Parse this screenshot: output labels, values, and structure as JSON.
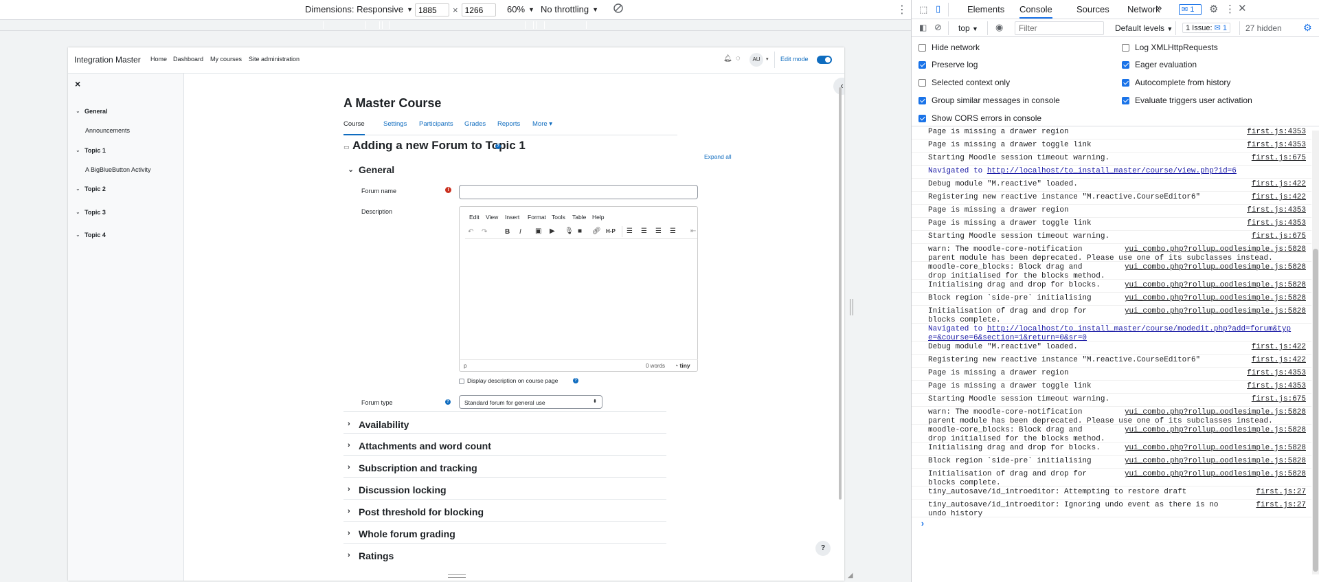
{
  "device_toolbar": {
    "dimensions_label": "Dimensions: Responsive",
    "width": "1885",
    "times": "×",
    "height": "1266",
    "zoom": "60%",
    "throttle": "No throttling"
  },
  "site": {
    "brand": "Integration Master",
    "nav": [
      "Home",
      "Dashboard",
      "My courses",
      "Site administration"
    ],
    "avatar": "AU",
    "edit_mode": "Edit mode"
  },
  "drawer": {
    "close": "×",
    "sections": [
      {
        "name": "General",
        "activity": "Announcements"
      },
      {
        "name": "Topic 1",
        "activity": "A BigBlueButton Activity"
      },
      {
        "name": "Topic 2",
        "activity": ""
      },
      {
        "name": "Topic 3",
        "activity": ""
      },
      {
        "name": "Topic 4",
        "activity": ""
      }
    ]
  },
  "course": {
    "title": "A Master Course",
    "tabs": [
      "Course",
      "Settings",
      "Participants",
      "Grades",
      "Reports",
      "More"
    ],
    "form_title": "Adding a new Forum to Topic 1",
    "expand_all": "Expand all",
    "general": "General",
    "forum_name_label": "Forum name",
    "forum_name_value": "",
    "description_label": "Description",
    "editor_menu": [
      "Edit",
      "View",
      "Insert",
      "Format",
      "Tools",
      "Table",
      "Help"
    ],
    "editor_status_path": "p",
    "editor_words": "0 words",
    "editor_brand": "tiny",
    "display_desc": "Display description on course page",
    "forum_type_label": "Forum type",
    "forum_type_value": "Standard forum for general use",
    "sections": [
      "Availability",
      "Attachments and word count",
      "Subscription and tracking",
      "Discussion locking",
      "Post threshold for blocking",
      "Whole forum grading",
      "Ratings"
    ]
  },
  "devtools": {
    "tabs": [
      "Elements",
      "Console",
      "Sources",
      "Network"
    ],
    "more": "»",
    "msg_badge": "1",
    "context": "top",
    "filter_placeholder": "Filter",
    "levels": "Default levels",
    "issues": "1 Issue:",
    "issues_count": "1",
    "hidden": "27 hidden",
    "settings_left": [
      {
        "label": "Hide network",
        "checked": false
      },
      {
        "label": "Preserve log",
        "checked": true
      },
      {
        "label": "Selected context only",
        "checked": false
      },
      {
        "label": "Group similar messages in console",
        "checked": true
      },
      {
        "label": "Show CORS errors in console",
        "checked": true
      }
    ],
    "settings_right": [
      {
        "label": "Log XMLHttpRequests",
        "checked": false
      },
      {
        "label": "Eager evaluation",
        "checked": true
      },
      {
        "label": "Autocomplete from history",
        "checked": true
      },
      {
        "label": "Evaluate triggers user activation",
        "checked": true
      }
    ],
    "log": [
      {
        "msg": "Page is missing a drawer region",
        "src": "first.js:4353",
        "type": ""
      },
      {
        "msg": "Page is missing a drawer toggle link",
        "src": "first.js:4353",
        "type": ""
      },
      {
        "msg": "Starting Moodle session timeout warning.",
        "src": "first.js:675",
        "type": ""
      },
      {
        "msg": "Navigated to ",
        "link": "http://localhost/to_install_master/course/view.php?id=6",
        "src": "",
        "type": "nav"
      },
      {
        "msg": "Debug module \"M.reactive\" loaded.",
        "src": "first.js:422",
        "type": ""
      },
      {
        "msg": "Registering new reactive instance \"M.reactive.CourseEditor6\"",
        "src": "first.js:422",
        "type": ""
      },
      {
        "msg": "Page is missing a drawer region",
        "src": "first.js:4353",
        "type": ""
      },
      {
        "msg": "Page is missing a drawer toggle link",
        "src": "first.js:4353",
        "type": ""
      },
      {
        "msg": "Starting Moodle session timeout warning.",
        "src": "first.js:675",
        "type": ""
      },
      {
        "msg": "warn: The moodle-core-notification\nparent module has been deprecated. Please use one of its subclasses instead.",
        "src": "yui_combo.php?rollup…oodlesimple.js:5828",
        "type": "two"
      },
      {
        "msg": "moodle-core_blocks: Block drag and\ndrop initialised for the blocks method.",
        "src": "yui_combo.php?rollup…oodlesimple.js:5828",
        "type": "two"
      },
      {
        "msg": "Initialising drag and drop for blocks.",
        "src": "yui_combo.php?rollup…oodlesimple.js:5828",
        "type": ""
      },
      {
        "msg": "Block region `side-pre` initialising",
        "src": "yui_combo.php?rollup…oodlesimple.js:5828",
        "type": ""
      },
      {
        "msg": "Initialisation of drag and drop for\nblocks complete.",
        "src": "yui_combo.php?rollup…oodlesimple.js:5828",
        "type": "two"
      },
      {
        "msg": "Navigated to ",
        "link": "http://localhost/to_install_master/course/modedit.php?add=forum&typ\ne=&course=6&section=1&return=0&sr=0",
        "src": "",
        "type": "nav two"
      },
      {
        "msg": "Debug module \"M.reactive\" loaded.",
        "src": "first.js:422",
        "type": ""
      },
      {
        "msg": "Registering new reactive instance \"M.reactive.CourseEditor6\"",
        "src": "first.js:422",
        "type": ""
      },
      {
        "msg": "Page is missing a drawer region",
        "src": "first.js:4353",
        "type": ""
      },
      {
        "msg": "Page is missing a drawer toggle link",
        "src": "first.js:4353",
        "type": ""
      },
      {
        "msg": "Starting Moodle session timeout warning.",
        "src": "first.js:675",
        "type": ""
      },
      {
        "msg": "warn: The moodle-core-notification\nparent module has been deprecated. Please use one of its subclasses instead.",
        "src": "yui_combo.php?rollup…oodlesimple.js:5828",
        "type": "two"
      },
      {
        "msg": "moodle-core_blocks: Block drag and\ndrop initialised for the blocks method.",
        "src": "yui_combo.php?rollup…oodlesimple.js:5828",
        "type": "two"
      },
      {
        "msg": "Initialising drag and drop for blocks.",
        "src": "yui_combo.php?rollup…oodlesimple.js:5828",
        "type": ""
      },
      {
        "msg": "Block region `side-pre` initialising",
        "src": "yui_combo.php?rollup…oodlesimple.js:5828",
        "type": ""
      },
      {
        "msg": "Initialisation of drag and drop for\nblocks complete.",
        "src": "yui_combo.php?rollup…oodlesimple.js:5828",
        "type": "two"
      },
      {
        "msg": "tiny_autosave/id_introeditor: Attempting to restore draft",
        "src": "first.js:27",
        "type": ""
      },
      {
        "msg": "tiny_autosave/id_introeditor: Ignoring undo event as there is no\nundo history",
        "src": "first.js:27",
        "type": "two"
      }
    ],
    "prompt": "›"
  },
  "colors": {
    "accent": "#0f6cbf",
    "devtools_blue": "#1a73e8"
  }
}
